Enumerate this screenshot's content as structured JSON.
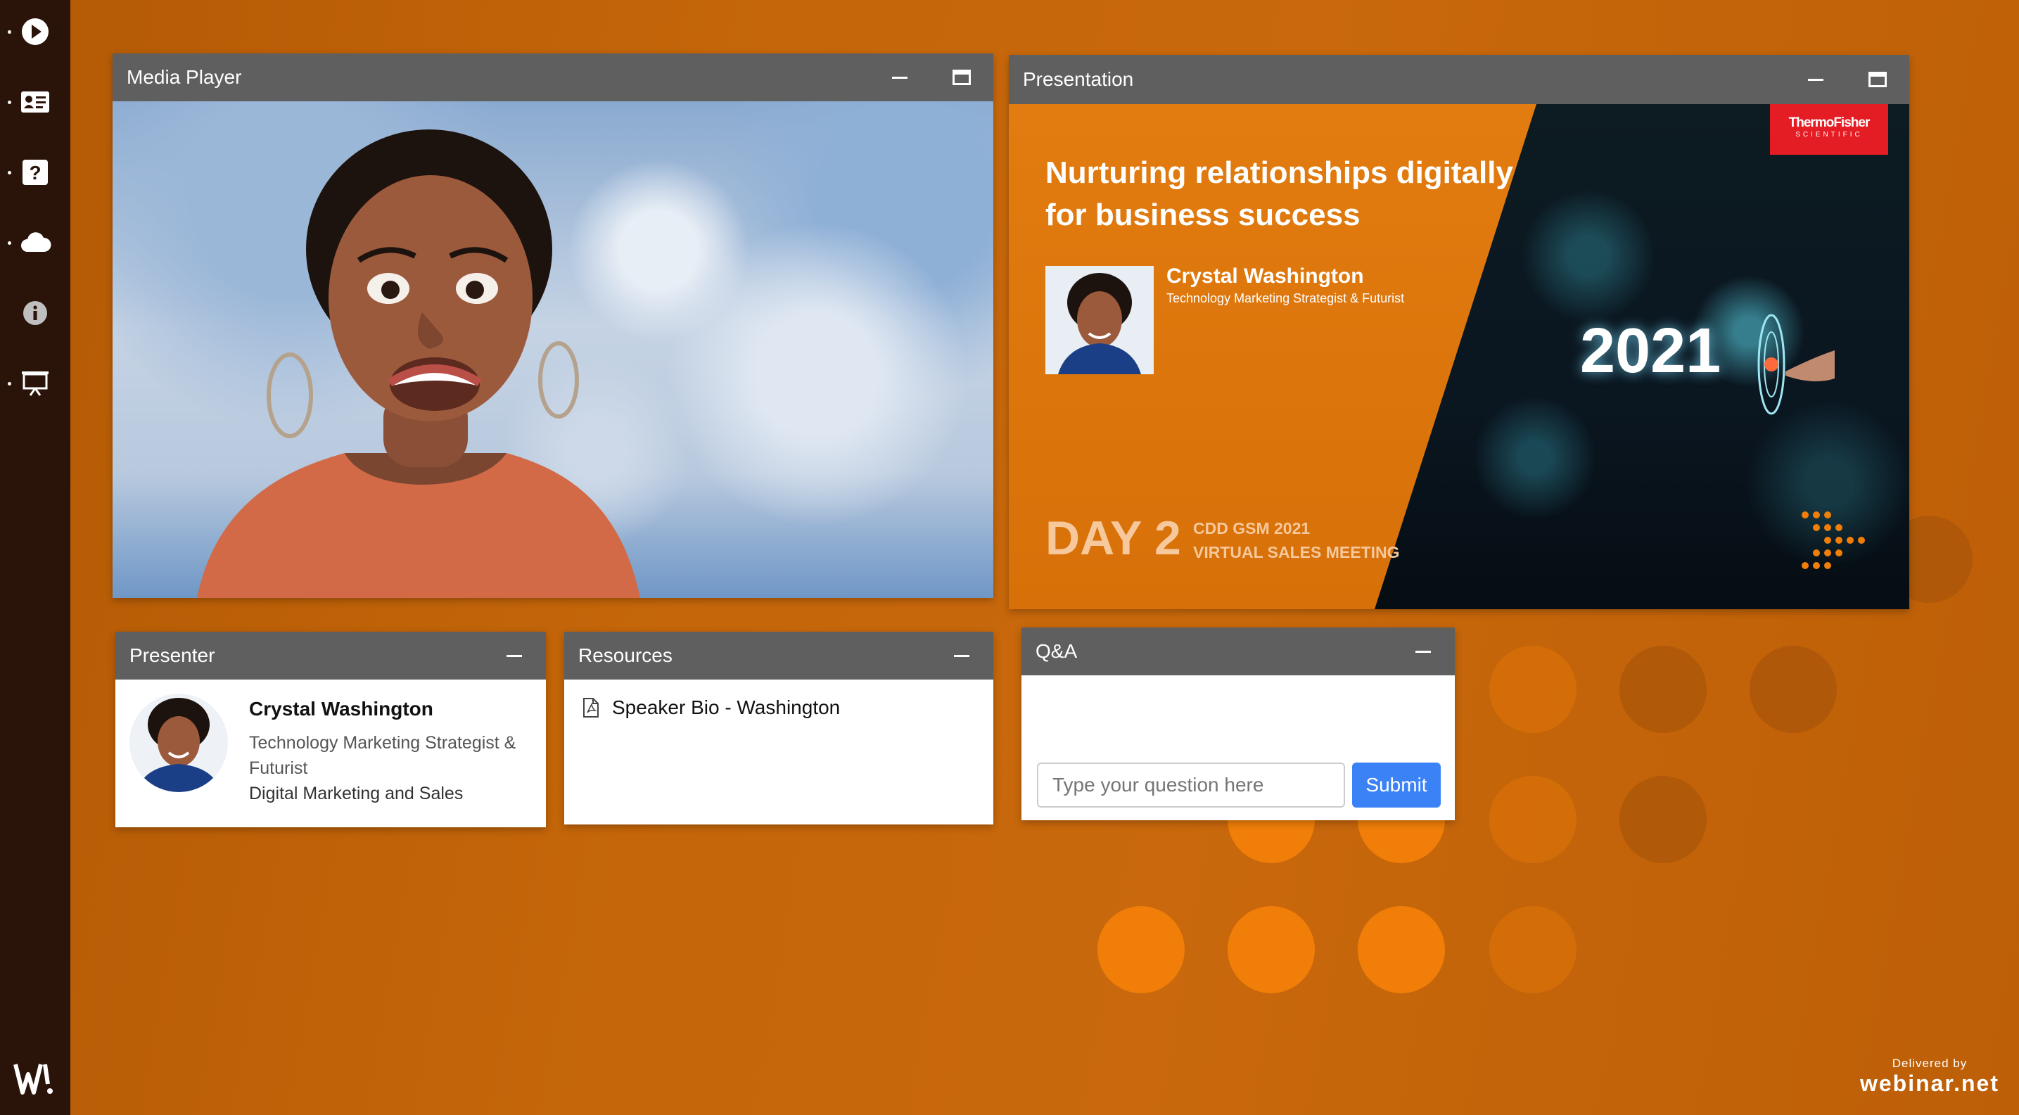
{
  "sidebar": {
    "items": [
      {
        "icon": "play-icon"
      },
      {
        "icon": "contact-card-icon"
      },
      {
        "icon": "question-icon"
      },
      {
        "icon": "cloud-icon"
      },
      {
        "icon": "info-icon"
      },
      {
        "icon": "presentation-icon"
      }
    ],
    "logo": "webinar-logo-icon"
  },
  "media_player": {
    "title": "Media Player"
  },
  "presentation": {
    "title": "Presentation",
    "slide": {
      "headline_line1": "Nurturing relationships digitally",
      "headline_line2": "for business success",
      "speaker_name": "Crystal Washington",
      "speaker_title": "Technology Marketing Strategist & Futurist",
      "day_label": "DAY 2",
      "event_line1": "CDD GSM 2021",
      "event_line2": "VIRTUAL SALES MEETING",
      "year": "2021",
      "brand_line1": "ThermoFisher",
      "brand_line2": "SCIENTIFIC"
    }
  },
  "presenter": {
    "title": "Presenter",
    "name": "Crystal Washington",
    "role_line1": "Technology Marketing Strategist &",
    "role_line2": "Futurist",
    "department": "Digital Marketing and Sales"
  },
  "resources": {
    "title": "Resources",
    "items": [
      {
        "label": "Speaker Bio - Washington",
        "icon": "pdf-file-icon"
      }
    ]
  },
  "qa": {
    "title": "Q&A",
    "input_placeholder": "Type your question here",
    "submit_label": "Submit"
  },
  "footer": {
    "delivered_by": "Delivered by",
    "brand": "webinar.net"
  },
  "colors": {
    "accent": "#3b82f6",
    "header": "#5f5f5f",
    "sidebar": "#2a1308",
    "background": "#c5660a"
  }
}
